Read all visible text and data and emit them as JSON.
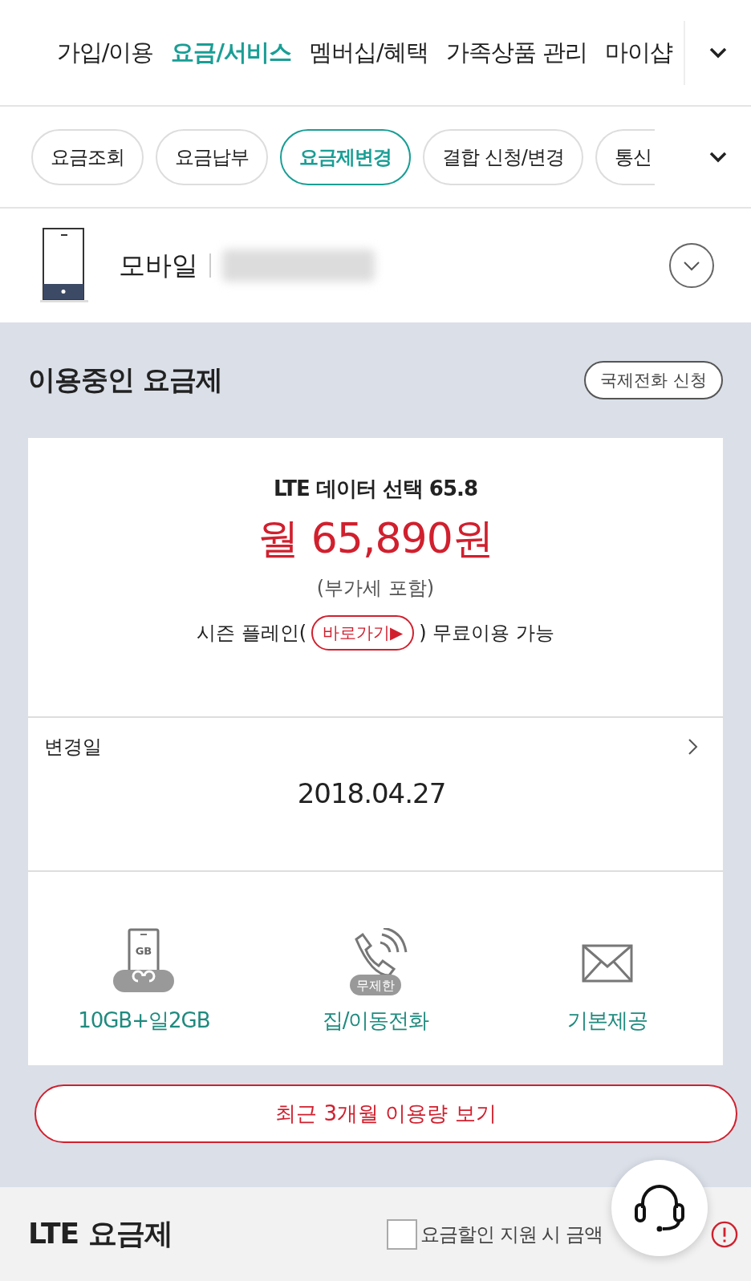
{
  "top_nav": {
    "items": [
      {
        "label": "가입/이용",
        "selected": false
      },
      {
        "label": "요금/서비스",
        "selected": true
      },
      {
        "label": "멤버십/혜택",
        "selected": false
      },
      {
        "label": "가족상품 관리",
        "selected": false
      },
      {
        "label": "마이샵",
        "selected": false
      }
    ]
  },
  "sub_tabs": [
    {
      "label": "요금조회",
      "selected": false
    },
    {
      "label": "요금납부",
      "selected": false
    },
    {
      "label": "요금제변경",
      "selected": true
    },
    {
      "label": "결합 신청/변경",
      "selected": false
    },
    {
      "label": "통신",
      "selected": false
    }
  ],
  "line": {
    "type": "모바일"
  },
  "current_plan": {
    "title": "이용중인 요금제",
    "intl_button": "국제전화 신청",
    "plan_name": "LTE 데이터 선택 65.8",
    "price": "월 65,890원",
    "vat_note": "(부가세 포함)",
    "promo": {
      "before": "시즌 플레인(",
      "link": "바로가기▶",
      "after": ") 무료이용 가능"
    },
    "change_date_label": "변경일",
    "change_date": "2018.04.27",
    "features": [
      {
        "kind": "data",
        "icon_text": "GB",
        "label": "10GB+일2GB"
      },
      {
        "kind": "call",
        "icon_text": "무제한",
        "label": "집/이동전화"
      },
      {
        "kind": "sms",
        "label": "기본제공"
      }
    ],
    "usage_button": "최근 3개월 이용량 보기"
  },
  "lte_section": {
    "title": "LTE 요금제",
    "discount_checkbox": {
      "label": "요금할인 지원 시 금액",
      "checked": false
    }
  }
}
